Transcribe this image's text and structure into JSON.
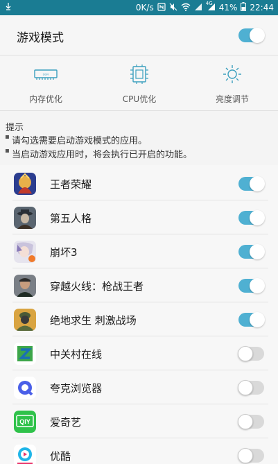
{
  "status_bar": {
    "left_icon": "download-icon",
    "speed": "0K/s",
    "network_type": "4G",
    "battery": "41%",
    "time": "22:44"
  },
  "game_mode": {
    "title": "游戏模式",
    "enabled": true
  },
  "features": [
    {
      "label": "内存优化",
      "icon": "memory-icon"
    },
    {
      "label": "CPU优化",
      "icon": "cpu-icon"
    },
    {
      "label": "亮度调节",
      "icon": "brightness-icon"
    }
  ],
  "hints": {
    "title": "提示",
    "lines": [
      "请勾选需要启动游戏模式的应用。",
      "当启动游戏应用时，将会执行已开启的功能。"
    ]
  },
  "apps": [
    {
      "name": "王者荣耀",
      "enabled": true
    },
    {
      "name": "第五人格",
      "enabled": true
    },
    {
      "name": "崩坏3",
      "enabled": true
    },
    {
      "name": "穿越火线：枪战王者",
      "enabled": true
    },
    {
      "name": "绝地求生 刺激战场",
      "enabled": true
    },
    {
      "name": "中关村在线",
      "enabled": false
    },
    {
      "name": "夸克浏览器",
      "enabled": false
    },
    {
      "name": "爱奇艺",
      "enabled": false
    },
    {
      "name": "优酷",
      "enabled": false
    }
  ],
  "colors": {
    "status_bar": "#1a7c93",
    "toggle_on": "#4fb0d2",
    "toggle_off": "#d9d9d9"
  }
}
